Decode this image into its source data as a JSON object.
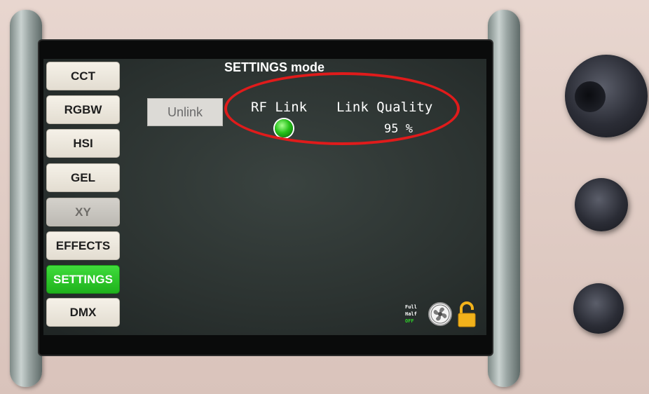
{
  "screen": {
    "title": "SETTINGS mode",
    "unlink_label": "Unlink",
    "rf_link_label": "RF Link",
    "rf_link_status_color": "#27c31a",
    "link_quality_label": "Link Quality",
    "link_quality_value": "95 %",
    "fan_modes": [
      "Full",
      "Half",
      "OFF"
    ],
    "icons": [
      "fan-icon",
      "padlock-open-icon"
    ]
  },
  "mode_buttons": [
    {
      "label": "CCT",
      "state": "normal"
    },
    {
      "label": "RGBW",
      "state": "normal"
    },
    {
      "label": "HSI",
      "state": "normal"
    },
    {
      "label": "GEL",
      "state": "normal"
    },
    {
      "label": "XY",
      "state": "disabled"
    },
    {
      "label": "EFFECTS",
      "state": "normal"
    },
    {
      "label": "SETTINGS",
      "state": "active"
    },
    {
      "label": "DMX",
      "state": "normal"
    }
  ],
  "colors": {
    "active_button": "#2ec42a",
    "annotation_ring": "#e01b1b",
    "screen_bg": "#2b3230"
  }
}
